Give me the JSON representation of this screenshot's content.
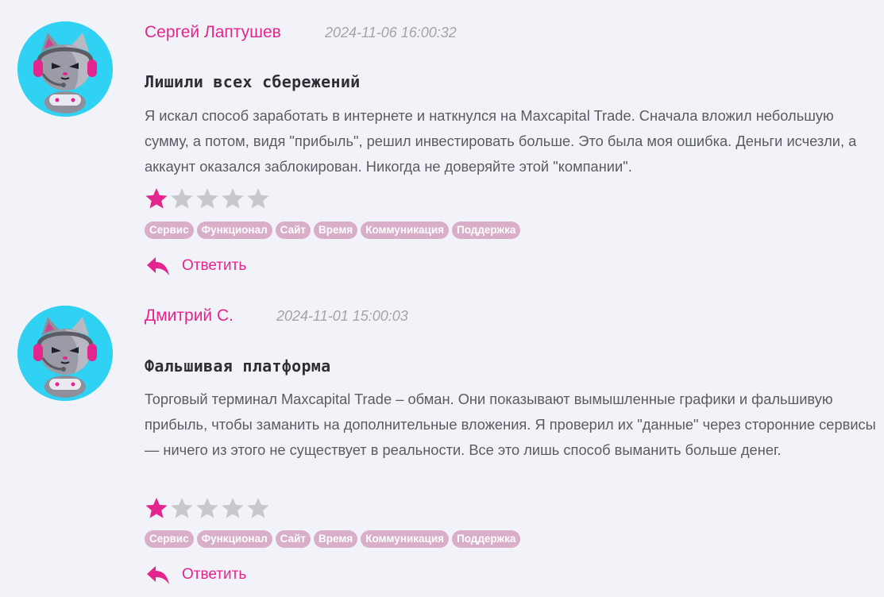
{
  "reviews": [
    {
      "author": "Сергей Лаптушев",
      "date": "2024-11-06 16:00:32",
      "title": "Лишили всех сбережений",
      "text": "Я искал способ заработать в интернете и наткнулся на Maxcapital Trade. Сначала вложил небольшую сумму, а потом, видя \"прибыль\", решил инвестировать больше. Это была моя ошибка. Деньги исчезли, а аккаунт оказался заблокирован. Никогда не доверяйте этой \"компании\".",
      "rating": 1,
      "rating_max": 5,
      "tags": [
        "Сервис",
        "Функционал",
        "Сайт",
        "Время",
        "Коммуникация",
        "Поддержка"
      ],
      "reply_label": "Ответить",
      "avatar_icon": "gamer-cat-avatar-icon"
    },
    {
      "author": "Дмитрий С.",
      "date": "2024-11-01 15:00:03",
      "title": "Фальшивая платформа",
      "text": "Торговый терминал Maxcapital Trade – обман. Они показывают вымышленные графики и фальшивую прибыль, чтобы заманить на дополнительные вложения. Я проверил их \"данные\" через сторонние сервисы — ничего из этого не существует в реальности. Все это лишь способ выманить больше денег.",
      "rating": 1,
      "rating_max": 5,
      "tags": [
        "Сервис",
        "Функционал",
        "Сайт",
        "Время",
        "Коммуникация",
        "Поддержка"
      ],
      "reply_label": "Ответить",
      "avatar_icon": "gamer-cat-avatar-icon"
    }
  ],
  "colors": {
    "accent": "#e5258e",
    "star_filled": "#e5258e",
    "star_empty": "#c9c9cc",
    "tag_bg": "#d9aec8",
    "avatar_bg": "#2fd2f2",
    "page_bg": "#f2f3f8"
  }
}
